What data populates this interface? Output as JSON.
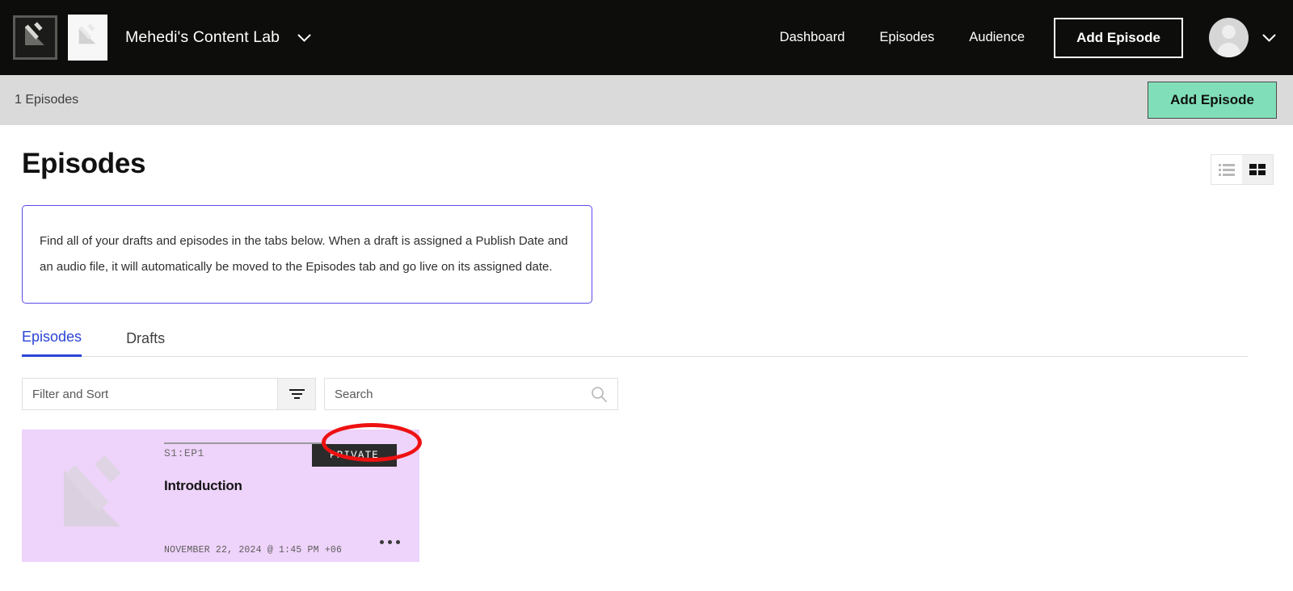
{
  "topnav": {
    "logo_icon": "broken-image-icon",
    "logo_alt_icon": "broken-image-icon",
    "brand_name": "Mehedi's Content Lab",
    "brand_caret_icon": "chevron-down-icon",
    "links": [
      {
        "label": "Dashboard"
      },
      {
        "label": "Episodes"
      },
      {
        "label": "Audience"
      }
    ],
    "add_episode_label": "Add Episode",
    "avatar_icon": "user-avatar-icon",
    "avatar_caret_icon": "chevron-down-icon"
  },
  "subbar": {
    "episode_count": "1 Episodes",
    "add_episode_label": "Add Episode",
    "button_color": "#80dfb8"
  },
  "page": {
    "title": "Episodes",
    "accent_color": "#2b44d6",
    "info_border_color": "#5b4ae8",
    "info_lines": [
      "Find all of your drafts and episodes in the tabs below. When a draft is assigned a Publish Date and",
      "an audio file, it will automatically be moved to the Episodes tab and go live on its assigned date."
    ]
  },
  "view_toggle": {
    "list_icon": "list-view-icon",
    "grid_icon": "grid-view-icon",
    "active": "grid"
  },
  "tabs": [
    {
      "label": "Episodes",
      "active": true
    },
    {
      "label": "Drafts",
      "active": false
    }
  ],
  "filters": {
    "filter_placeholder": "Filter and Sort",
    "filter_value": "",
    "filter_icon": "filter-funnel-icon",
    "search_placeholder": "Search",
    "search_value": "",
    "search_icon": "search-icon"
  },
  "episodes": [
    {
      "thumb_icon": "broken-image-icon",
      "season_episode": "S1:EP1",
      "badge": "PRIVATE",
      "title": "Introduction",
      "date": "NOVEMBER 22, 2024 @ 1:45 PM +06",
      "menu_icon": "more-options-icon",
      "card_color": "#eed3fa",
      "badge_color": "#2b2b2b"
    }
  ],
  "annotation": {
    "shape": "ellipse",
    "color": "#ee1111",
    "target": "PRIVATE"
  }
}
